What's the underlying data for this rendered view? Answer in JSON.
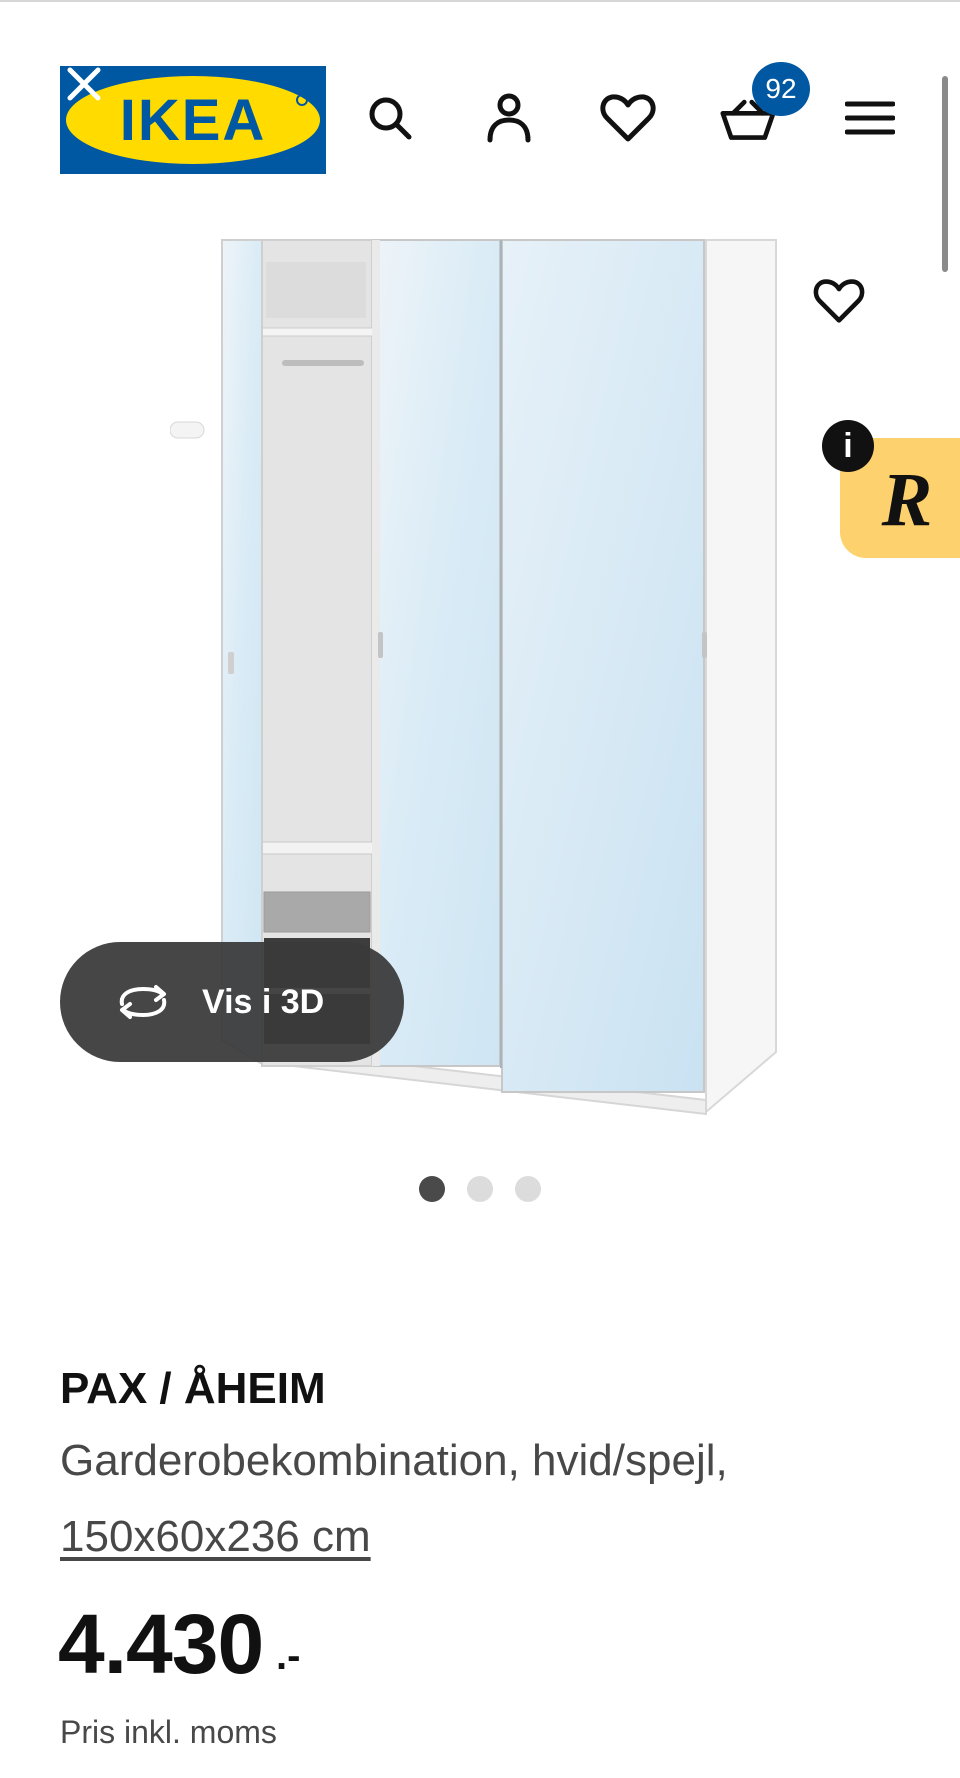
{
  "header": {
    "logo_text": "IKEA",
    "cart_count": "92",
    "icons": [
      "close-icon",
      "search-icon",
      "user-icon",
      "heart-icon",
      "cart-icon",
      "menu-icon"
    ],
    "brand_blue": "#0058a3",
    "brand_yellow": "#ffdb00"
  },
  "gallery": {
    "view_3d_label": "Vis i 3D",
    "slide_count": 3,
    "active_slide": 1,
    "favourite_icon": "heart-icon"
  },
  "extension_badge": {
    "letter": "R",
    "info_symbol": "i",
    "color": "#fdd26e"
  },
  "product": {
    "name": "PAX / ÅHEIM",
    "description": "Garderobekombination, hvid/spejl,",
    "size": "150x60x236 cm",
    "price": "4.430",
    "price_suffix": ".-",
    "vat_note": "Pris inkl. moms"
  }
}
